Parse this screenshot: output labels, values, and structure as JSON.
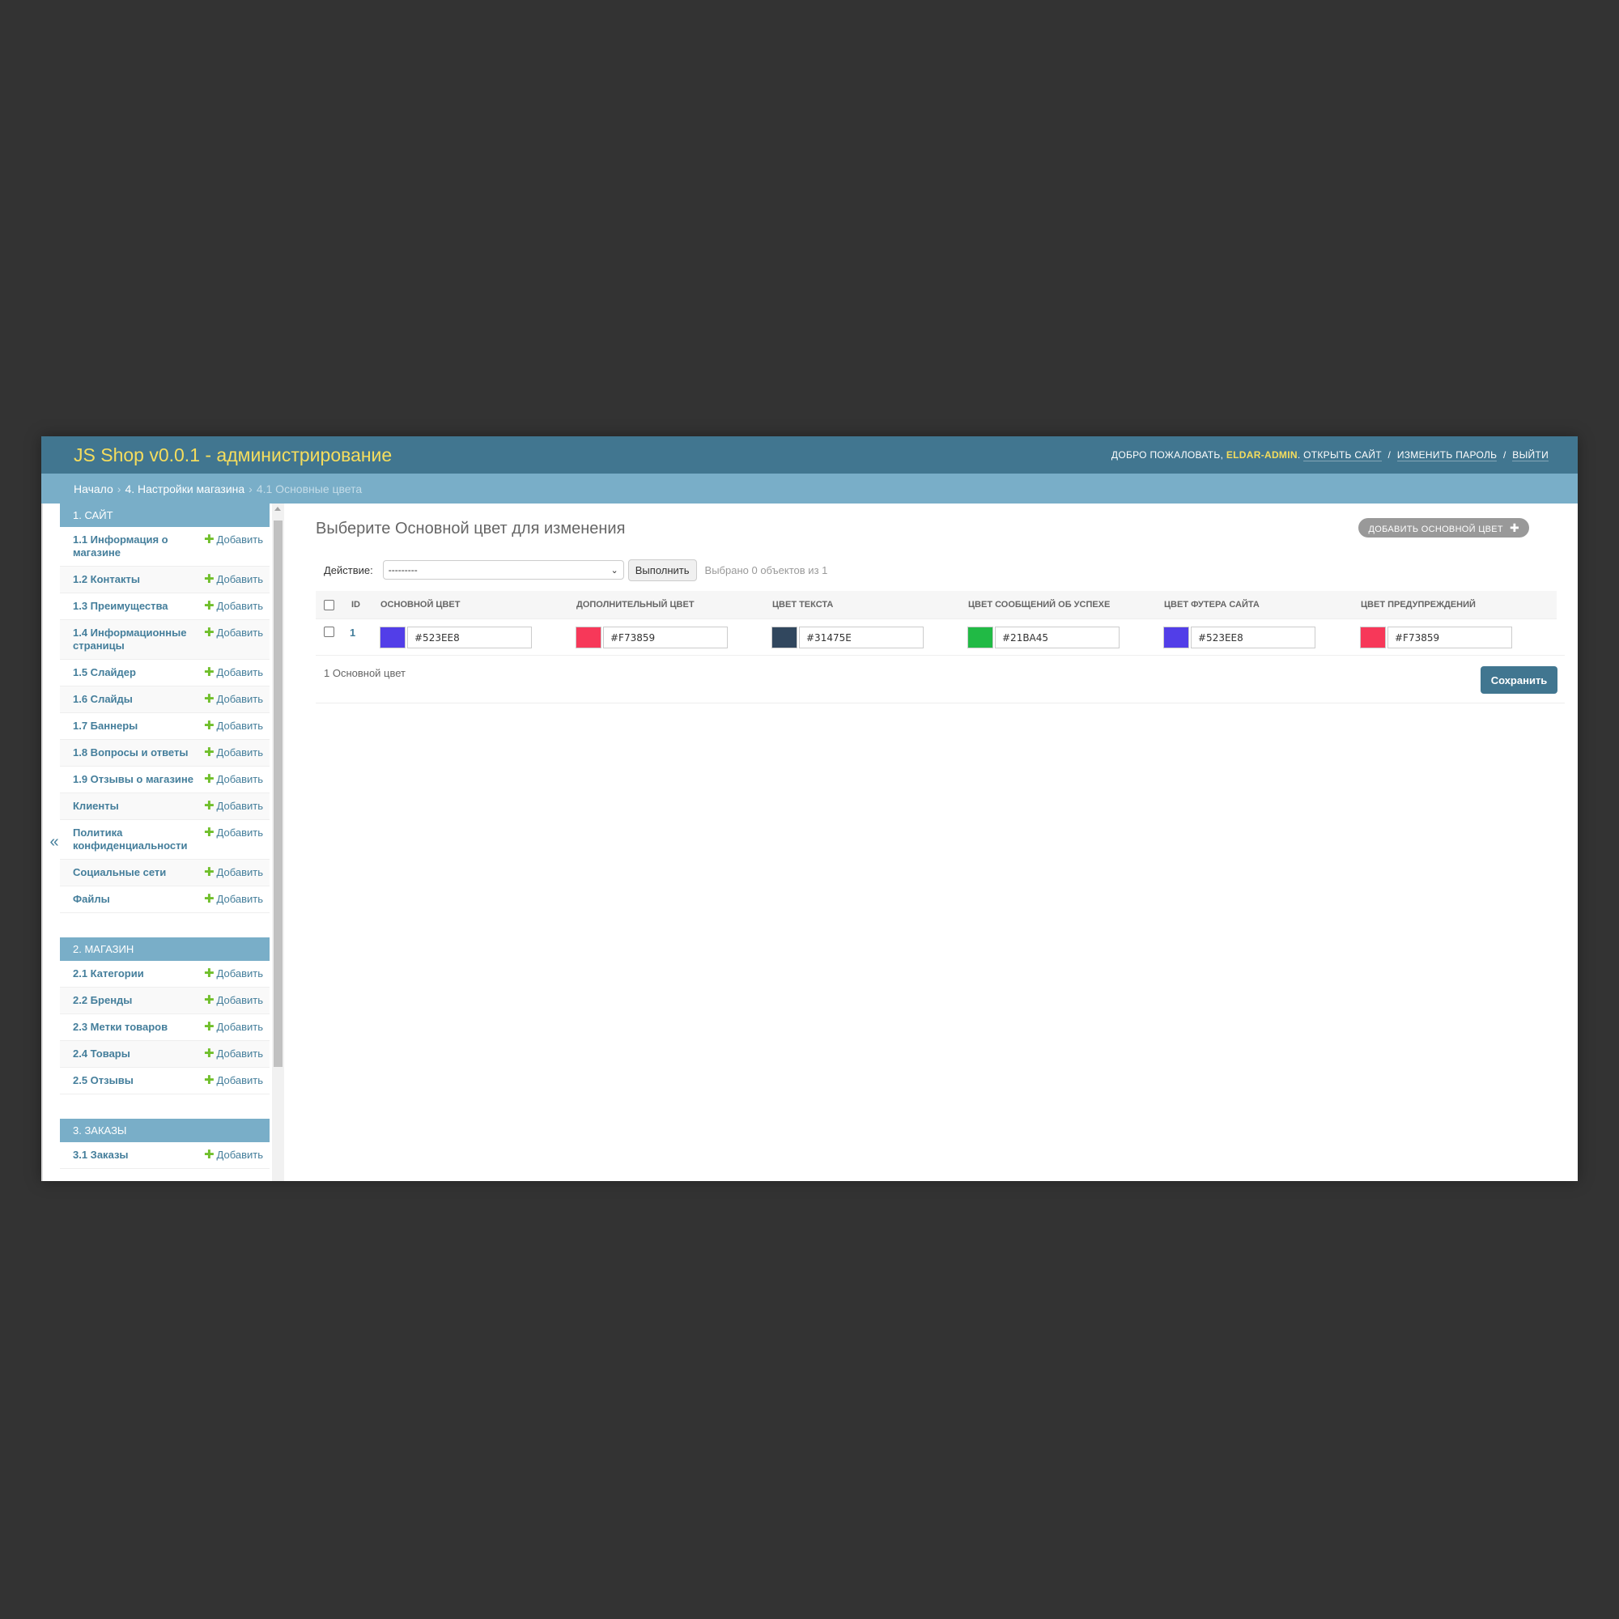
{
  "header": {
    "site_title": "JS Shop v0.0.1 - администрирование",
    "welcome": "Добро пожаловать,",
    "username": "ELDAR-ADMIN",
    "links": [
      "Открыть сайт",
      "Изменить пароль",
      "Выйти"
    ]
  },
  "breadcrumbs": {
    "home": "Начало",
    "section": "4. Настройки магазина",
    "current": "4.1 Основные цвета"
  },
  "sidebar": {
    "collapse_label": "«",
    "add_label": "Добавить",
    "apps": [
      {
        "caption": "1. Сайт",
        "models": [
          "1.1 Информация о магазине",
          "1.2 Контакты",
          "1.3 Преимущества",
          "1.4 Информационные страницы",
          "1.5 Слайдер",
          "1.6 Слайды",
          "1.7 Баннеры",
          "1.8 Вопросы и ответы",
          "1.9 Отзывы о магазине",
          "Клиенты",
          "Политика конфиденциальности",
          "Социальные сети",
          "Файлы"
        ]
      },
      {
        "caption": "2. Магазин",
        "models": [
          "2.1 Категории",
          "2.2 Бренды",
          "2.3 Метки товаров",
          "2.4 Товары",
          "2.5 Отзывы"
        ]
      },
      {
        "caption": "3. Заказы",
        "models": [
          "3.1 Заказы"
        ]
      }
    ]
  },
  "content": {
    "title": "Выберите Основной цвет для изменения",
    "add_button": "Добавить Основной цвет",
    "actions": {
      "label": "Действие:",
      "selected": "---------",
      "go": "Выполнить",
      "counter": "Выбрано 0 объектов из 1"
    },
    "table": {
      "headers": [
        "ID",
        "Основной цвет",
        "Дополнительный цвет",
        "Цвет текста",
        "Цвет сообщений об успехе",
        "Цвет футера сайта",
        "Цвет предупреждений"
      ],
      "rows": [
        {
          "id": "1",
          "colors": [
            "#523EE8",
            "#F73859",
            "#31475E",
            "#21BA45",
            "#523EE8",
            "#F73859"
          ]
        }
      ]
    },
    "paginator": "1 Основной цвет",
    "save": "Сохранить"
  }
}
